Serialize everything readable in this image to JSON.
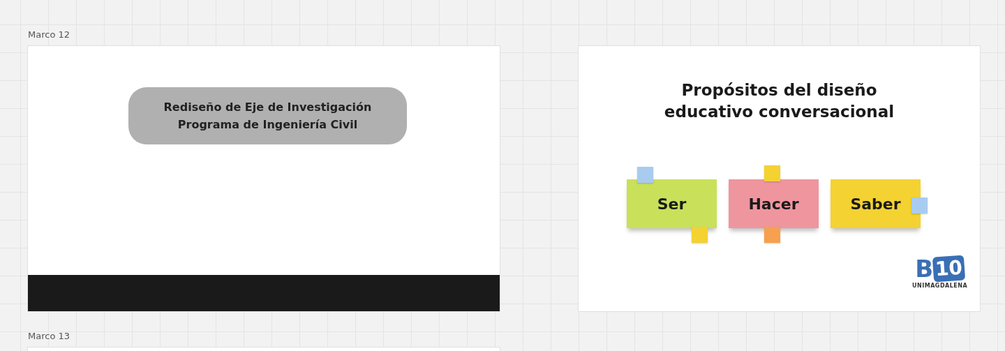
{
  "frames": [
    {
      "label": "Marco 12",
      "kind": "title-slide",
      "title_lines": [
        "Rediseño de Eje de Investigación",
        "Programa de Ingeniería Civil"
      ]
    },
    {
      "kind": "notes-slide",
      "title_lines": [
        "Propósitos del diseño",
        "educativo conversacional"
      ],
      "notes": [
        {
          "text": "Ser",
          "color": "#c9e05a"
        },
        {
          "text": "Hacer",
          "color": "#ef959e"
        },
        {
          "text": "Saber",
          "color": "#f3d232"
        }
      ],
      "logo": {
        "letter": "B",
        "number": "10",
        "caption": "UNIMAGDALENA"
      }
    },
    {
      "label": "Marco 13",
      "kind": "blank"
    }
  ]
}
